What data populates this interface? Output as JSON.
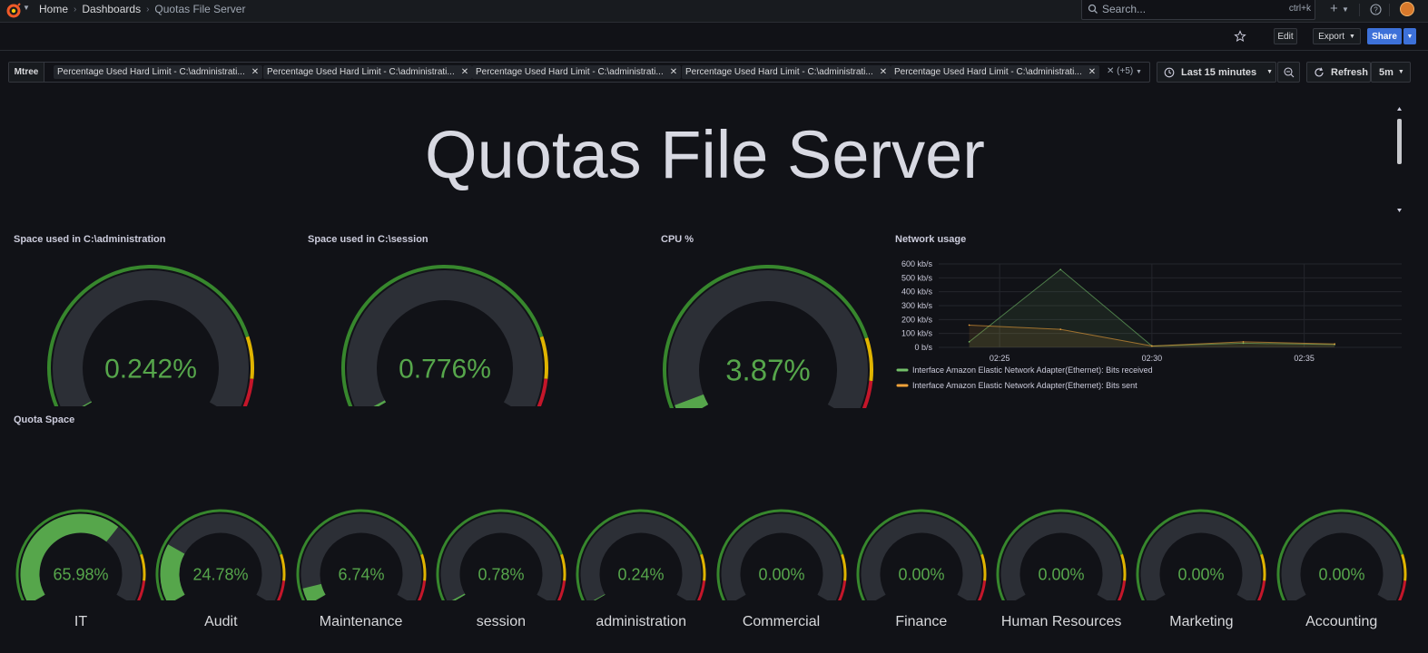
{
  "topbar": {
    "breadcrumbs": [
      "Home",
      "Dashboards",
      "Quotas File Server"
    ],
    "search_placeholder": "Search...",
    "search_shortcut": "ctrl+k",
    "plus_label": "+",
    "help_label": "?"
  },
  "toolbar": {
    "edit_label": "Edit",
    "export_label": "Export",
    "share_label": "Share"
  },
  "variables": {
    "label": "Mtree",
    "chips": [
      "Percentage Used Hard Limit - C:\\administrati...",
      "Percentage Used Hard Limit - C:\\administrati...",
      "Percentage Used Hard Limit - C:\\administrati...",
      "Percentage Used Hard Limit - C:\\administrati...",
      "Percentage Used Hard Limit - C:\\administrati..."
    ],
    "more_label": "(+5)"
  },
  "time": {
    "range_label": "Last 15 minutes",
    "refresh_label": "Refresh",
    "interval_label": "5m"
  },
  "dashboard_title": "Quotas File Server",
  "panels": {
    "admin_space": {
      "title": "Space used in C:\\administration",
      "value": "0.242%",
      "fraction": 0.00242
    },
    "session_space": {
      "title": "Space used in C:\\session",
      "value": "0.776%",
      "fraction": 0.00776
    },
    "cpu": {
      "title": "CPU %",
      "value": "3.87%",
      "fraction": 0.0387
    },
    "network": {
      "title": "Network usage"
    },
    "quota": {
      "title": "Quota Space"
    }
  },
  "quota_gauges": [
    {
      "name": "IT",
      "value": "65.98%",
      "fraction": 0.6598
    },
    {
      "name": "Audit",
      "value": "24.78%",
      "fraction": 0.2478
    },
    {
      "name": "Maintenance",
      "value": "6.74%",
      "fraction": 0.0674
    },
    {
      "name": "session",
      "value": "0.78%",
      "fraction": 0.0078
    },
    {
      "name": "administration",
      "value": "0.24%",
      "fraction": 0.0024
    },
    {
      "name": "Commercial",
      "value": "0.00%",
      "fraction": 0
    },
    {
      "name": "Finance",
      "value": "0.00%",
      "fraction": 0
    },
    {
      "name": "Human Resources",
      "value": "0.00%",
      "fraction": 0
    },
    {
      "name": "Marketing",
      "value": "0.00%",
      "fraction": 0
    },
    {
      "name": "Accounting",
      "value": "0.00%",
      "fraction": 0
    }
  ],
  "colors": {
    "green": "#37872d",
    "green_bright": "#56a64b",
    "yellow": "#e0b400",
    "red": "#c4162a",
    "track": "#2c2f36",
    "received": "#73bf69",
    "sent": "#f2a33a"
  },
  "chart_data": {
    "type": "line",
    "title": "Network usage",
    "y_ticks": [
      "0 b/s",
      "100 kb/s",
      "200 kb/s",
      "300 kb/s",
      "400 kb/s",
      "500 kb/s",
      "600 kb/s"
    ],
    "x_ticks": [
      "02:25",
      "02:30",
      "02:35"
    ],
    "ylim": [
      0,
      600
    ],
    "y_unit": "kb/s",
    "x": [
      "02:24",
      "02:27",
      "02:30",
      "02:33",
      "02:36"
    ],
    "series": [
      {
        "name": "Interface Amazon Elastic Network Adapter(Ethernet): Bits received",
        "values": [
          40,
          560,
          10,
          30,
          20
        ]
      },
      {
        "name": "Interface Amazon Elastic Network Adapter(Ethernet): Bits sent",
        "values": [
          160,
          130,
          10,
          40,
          25
        ]
      }
    ],
    "legend_position": "bottom",
    "grid": true
  }
}
